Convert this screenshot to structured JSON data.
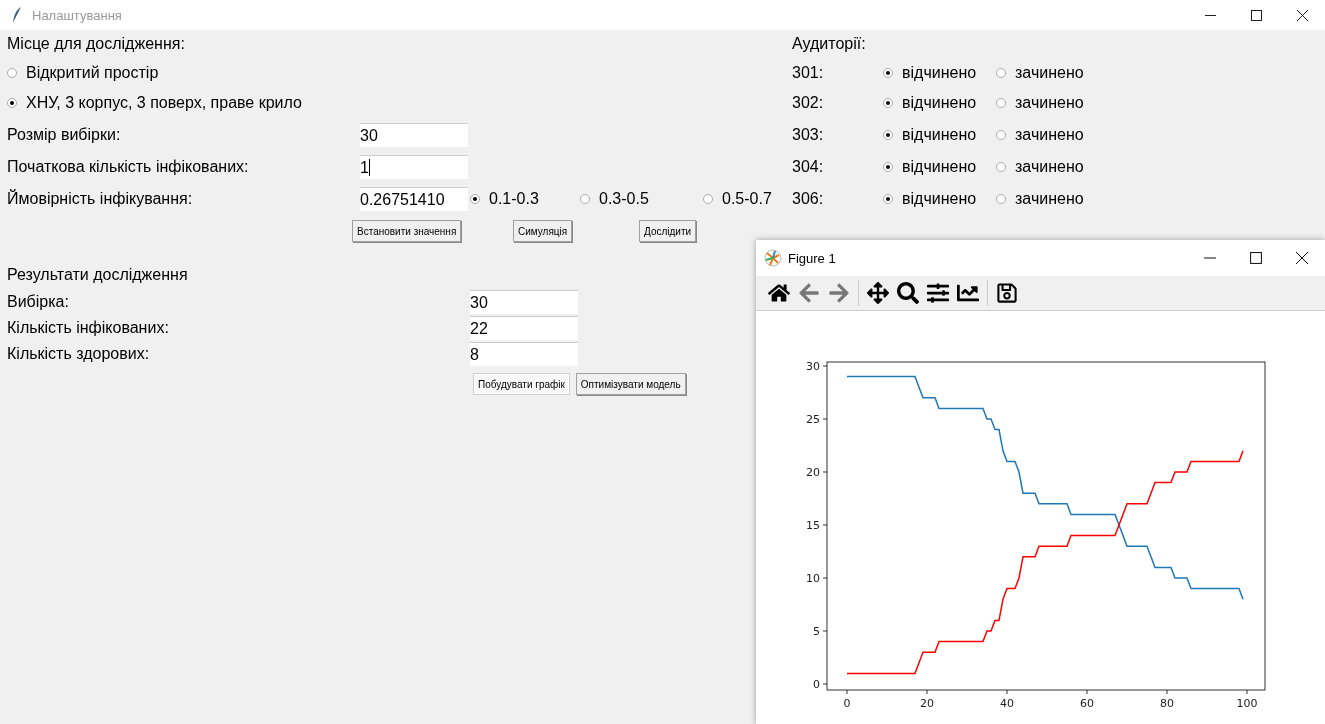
{
  "window": {
    "title": "Налаштування"
  },
  "location": {
    "label": "Місце для дослідження:",
    "options": [
      {
        "label": "Відкритий простір",
        "selected": false
      },
      {
        "label": "ХНУ, 3 корпус, 3 поверх, праве крило",
        "selected": true
      }
    ]
  },
  "fields": [
    {
      "label": "Розмір вибірки:",
      "value": "30",
      "focused": false
    },
    {
      "label": "Початкова кількість інфікованих:",
      "value": "1",
      "focused": true
    },
    {
      "label": "Ймовірність інфікування:",
      "value": "0.26751410",
      "focused": false
    }
  ],
  "ranges": [
    {
      "label": "0.1-0.3",
      "selected": true
    },
    {
      "label": "0.3-0.5",
      "selected": false
    },
    {
      "label": "0.5-0.7",
      "selected": false
    }
  ],
  "actions": [
    "Встановити значення",
    "Симуляція",
    "Дослідити"
  ],
  "rooms": {
    "label": "Аудиторії:",
    "items": [
      {
        "number": "301:",
        "options": [
          {
            "label": "відчинено",
            "selected": true
          },
          {
            "label": "зачинено",
            "selected": false
          }
        ]
      },
      {
        "number": "302:",
        "options": [
          {
            "label": "відчинено",
            "selected": true
          },
          {
            "label": "зачинено",
            "selected": false
          }
        ]
      },
      {
        "number": "303:",
        "options": [
          {
            "label": "відчинено",
            "selected": true
          },
          {
            "label": "зачинено",
            "selected": false
          }
        ]
      },
      {
        "number": "304:",
        "options": [
          {
            "label": "відчинено",
            "selected": true
          },
          {
            "label": "зачинено",
            "selected": false
          }
        ]
      },
      {
        "number": "306:",
        "options": [
          {
            "label": "відчинено",
            "selected": true
          },
          {
            "label": "зачинено",
            "selected": false
          }
        ]
      }
    ]
  },
  "results": {
    "title": "Результати дослідження",
    "rows": [
      {
        "label": "Вибірка:",
        "value": "30"
      },
      {
        "label": "Кількість інфікованих:",
        "value": "22"
      },
      {
        "label": "Кількість здорових:",
        "value": "8"
      }
    ],
    "buttons": [
      {
        "label": "Побудувати графік",
        "focused": true
      },
      {
        "label": "Оптимізувати модель",
        "focused": false
      }
    ]
  },
  "figure": {
    "title": "Figure 1",
    "chart_data": {
      "type": "line",
      "x": [
        0,
        1,
        2,
        3,
        4,
        5,
        6,
        7,
        8,
        9,
        10,
        11,
        12,
        13,
        14,
        15,
        16,
        17,
        18,
        19,
        20,
        21,
        22,
        23,
        24,
        25,
        26,
        27,
        28,
        29,
        30,
        31,
        32,
        33,
        34,
        35,
        36,
        37,
        38,
        39,
        40,
        41,
        42,
        43,
        44,
        45,
        46,
        47,
        48,
        49,
        50,
        51,
        52,
        53,
        54,
        55,
        56,
        57,
        58,
        59,
        60,
        61,
        62,
        63,
        64,
        65,
        66,
        67,
        68,
        69,
        70,
        71,
        72,
        73,
        74,
        75,
        76,
        77,
        78,
        79,
        80,
        81,
        82,
        83,
        84,
        85,
        86,
        87,
        88,
        89,
        90,
        91,
        92,
        93,
        94,
        95,
        96,
        97,
        98,
        99
      ],
      "xlim": [
        -5,
        104.5
      ],
      "ylim": [
        -0.57,
        30.38
      ],
      "xticks": [
        0,
        20,
        40,
        60,
        80,
        100
      ],
      "yticks": [
        0,
        5,
        10,
        15,
        20,
        25,
        30
      ],
      "series": [
        {
          "color": "#1f77b4",
          "values": [
            29,
            29,
            29,
            29,
            29,
            29,
            29,
            29,
            29,
            29,
            29,
            29,
            29,
            29,
            29,
            29,
            29,
            29,
            28,
            27,
            27,
            27,
            27,
            26,
            26,
            26,
            26,
            26,
            26,
            26,
            26,
            26,
            26,
            26,
            26,
            25,
            25,
            24,
            24,
            22,
            21,
            21,
            21,
            20,
            18,
            18,
            18,
            18,
            17,
            17,
            17,
            17,
            17,
            17,
            17,
            17,
            16,
            16,
            16,
            16,
            16,
            16,
            16,
            16,
            16,
            16,
            16,
            16,
            15,
            14,
            13,
            13,
            13,
            13,
            13,
            13,
            12,
            11,
            11,
            11,
            11,
            11,
            10,
            10,
            10,
            10,
            9,
            9,
            9,
            9,
            9,
            9,
            9,
            9,
            9,
            9,
            9,
            9,
            9,
            8
          ]
        },
        {
          "color": "#ff0000",
          "values": [
            1,
            1,
            1,
            1,
            1,
            1,
            1,
            1,
            1,
            1,
            1,
            1,
            1,
            1,
            1,
            1,
            1,
            1,
            2,
            3,
            3,
            3,
            3,
            4,
            4,
            4,
            4,
            4,
            4,
            4,
            4,
            4,
            4,
            4,
            4,
            5,
            5,
            6,
            6,
            8,
            9,
            9,
            9,
            10,
            12,
            12,
            12,
            12,
            13,
            13,
            13,
            13,
            13,
            13,
            13,
            13,
            14,
            14,
            14,
            14,
            14,
            14,
            14,
            14,
            14,
            14,
            14,
            14,
            15,
            16,
            17,
            17,
            17,
            17,
            17,
            17,
            18,
            19,
            19,
            19,
            19,
            19,
            20,
            20,
            20,
            20,
            21,
            21,
            21,
            21,
            21,
            21,
            21,
            21,
            21,
            21,
            21,
            21,
            21,
            22
          ]
        }
      ]
    }
  }
}
